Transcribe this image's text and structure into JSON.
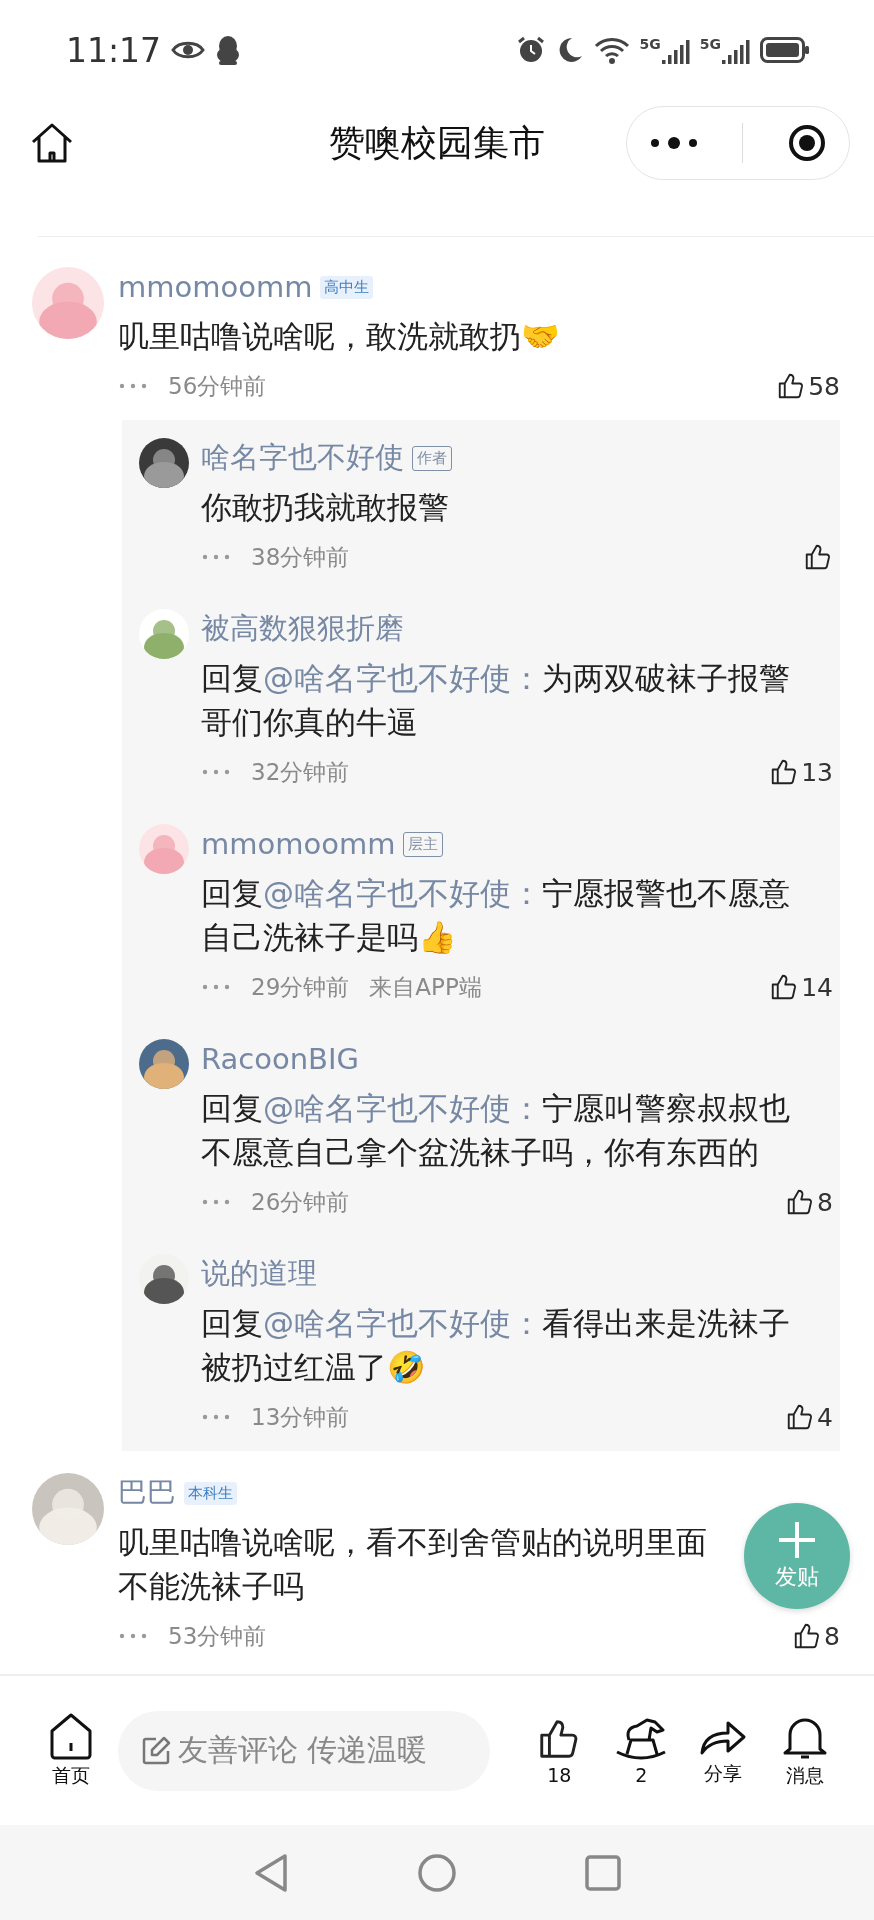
{
  "status_bar": {
    "time": "11:17",
    "network_labels": [
      "5G",
      "5G"
    ]
  },
  "nav": {
    "title": "赞噢校园集市"
  },
  "comments": [
    {
      "name": "mmomoomm",
      "badge": {
        "label": "高中生",
        "kind": "filled"
      },
      "lines": [
        "叽里咕噜说啥呢，敢洗就敢扔🤝"
      ],
      "time": "56分钟前",
      "likes": "58",
      "replies": [
        {
          "name": "啥名字也不好使",
          "badge": {
            "label": "作者",
            "kind": "outlined"
          },
          "text": "你敢扔我就敢报警",
          "time": "38分钟前"
        },
        {
          "name": "被高数狠狠折磨",
          "prefix": "回复",
          "mention": "@啥名字也不好使：",
          "text": "为两双破袜子报警哥们你真的牛逼",
          "time": "32分钟前",
          "likes": "13"
        },
        {
          "name": "mmomoomm",
          "badge": {
            "label": "层主",
            "kind": "outlined"
          },
          "prefix": "回复",
          "mention": "@啥名字也不好使：",
          "text": "宁愿报警也不愿意自己洗袜子是吗👍",
          "time": "29分钟前",
          "source": "来自APP端",
          "likes": "14"
        },
        {
          "name": "RacoonBIG",
          "prefix": "回复",
          "mention": "@啥名字也不好使：",
          "text": "宁愿叫警察叔叔也不愿意自己拿个盆洗袜子吗，你有东西的",
          "time": "26分钟前",
          "likes": "8"
        },
        {
          "name": "说的道理",
          "prefix": "回复",
          "mention": "@啥名字也不好使：",
          "text": "看得出来是洗袜子被扔过红温了🤣",
          "time": "13分钟前",
          "likes": "4"
        }
      ]
    },
    {
      "name": "巴巴",
      "badge": {
        "label": "本科生",
        "kind": "filled"
      },
      "lines": [
        "叽里咕噜说啥呢，看不到舍管贴的说明里面",
        "不能洗袜子吗"
      ],
      "time": "53分钟前",
      "likes": "8"
    }
  ],
  "fab": {
    "label": "发贴"
  },
  "bottom_bar": {
    "home_label": "首页",
    "placeholder": "友善评论 传递温暖",
    "like_count": "18",
    "horse_count": "2",
    "share_label": "分享",
    "message_label": "消息"
  }
}
